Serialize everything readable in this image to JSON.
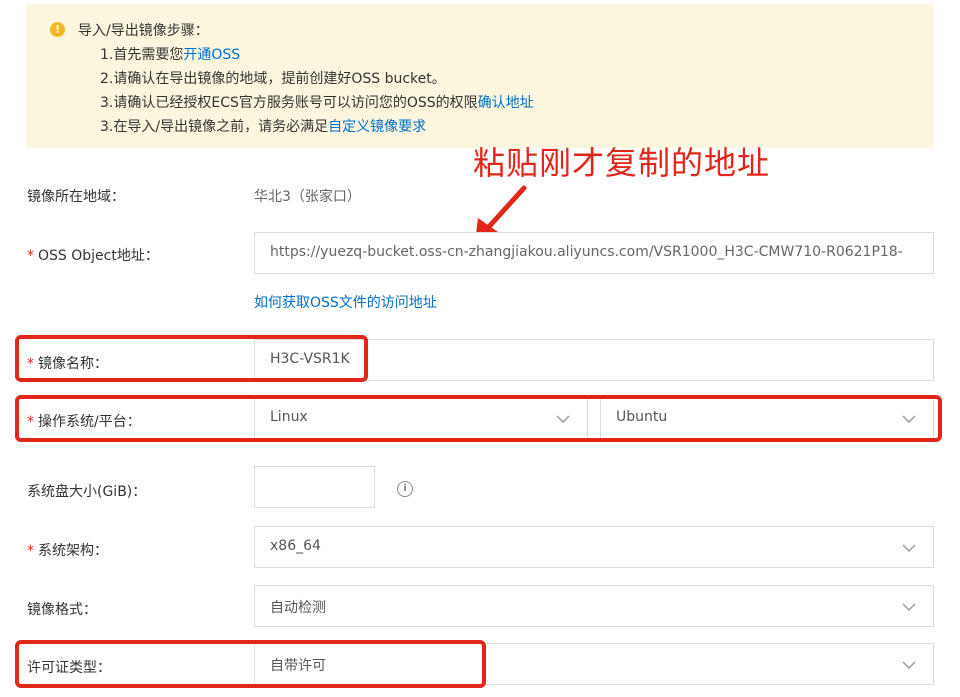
{
  "notice": {
    "title": "导入/导出镜像步骤：",
    "line1_text": "1.首先需要您",
    "line1_link": "开通OSS",
    "line2_text": "2.请确认在导出镜像的地域，提前创建好OSS bucket。",
    "line3_text": "3.请确认已经授权ECS官方服务账号可以访问您的OSS的权限",
    "line3_link": "确认地址",
    "line4_text": "3.在导入/导出镜像之前，请务必满足",
    "line4_link": "自定义镜像要求"
  },
  "annotation": "粘贴刚才复制的地址",
  "form": {
    "region_label": "镜像所在地域：",
    "region_value": "华北3（张家口）",
    "oss_label": "OSS Object地址：",
    "oss_value": "https://yuezq-bucket.oss-cn-zhangjiakou.aliyuncs.com/VSR1000_H3C-CMW710-R0621P18-",
    "oss_help": "如何获取OSS文件的访问地址",
    "name_label": "镜像名称：",
    "name_value": "H3C-VSR1K",
    "os_label": "操作系统/平台：",
    "os_value": "Linux",
    "platform_value": "Ubuntu",
    "disk_label": "系统盘大小(GiB)：",
    "disk_value": "",
    "arch_label": "系统架构：",
    "arch_value": "x86_64",
    "format_label": "镜像格式：",
    "format_value": "自动检测",
    "license_label": "许可证类型：",
    "license_value": "自带许可",
    "required_mark": "*"
  },
  "colors": {
    "notice_bg": "#fcf6df",
    "warning": "#f5b622",
    "link": "#0070cc",
    "highlight": "#e2261a"
  },
  "icons": [
    "warning-icon",
    "chevron-down-icon",
    "info-icon",
    "arrow-annotation"
  ]
}
